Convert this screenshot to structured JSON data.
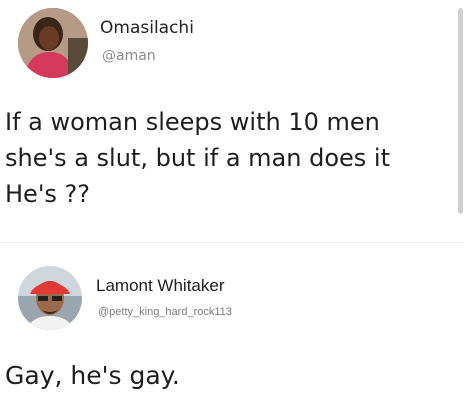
{
  "post1": {
    "author_name": "Omasilachi",
    "author_handle": "@aman",
    "text_lines": [
      "If a woman sleeps with 10 men",
      "she's a slut, but if a man does it",
      "He's ??"
    ]
  },
  "post2": {
    "author_name": "Lamont Whitaker",
    "author_handle": "@petty_king_hard_rock113",
    "text": "Gay, he's gay."
  }
}
